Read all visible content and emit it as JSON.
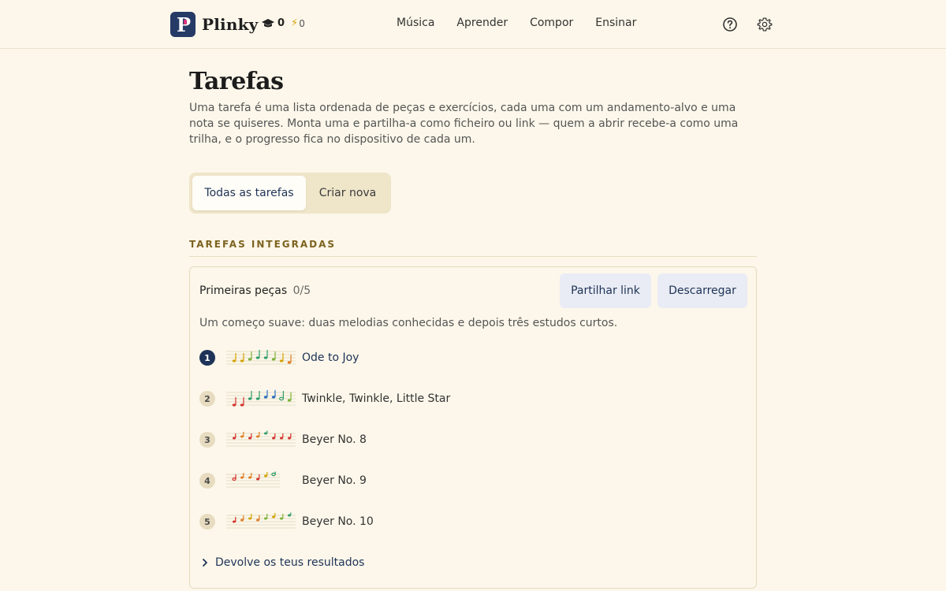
{
  "app": {
    "name": "Plinky",
    "logo_letter": "P",
    "streak_count": "0",
    "energy_count": "0",
    "brand_color": "#263a66",
    "accent_color": "#d6337a"
  },
  "nav": {
    "items": [
      "Música",
      "Aprender",
      "Compor",
      "Ensinar"
    ]
  },
  "icons": {
    "streak": "graduation-cap-icon",
    "energy": "lightning-icon",
    "help": "help-circle-icon",
    "settings": "gear-icon",
    "disclosure": "chevron-right-icon"
  },
  "page": {
    "title": "Tarefas",
    "intro": "Uma tarefa é uma lista ordenada de peças e exercícios, cada uma com um andamento-alvo e uma nota se quiseres. Monta uma e partilha-a como ficheiro ou link — quem a abrir recebe-a como uma trilha, e o progresso fica no dispositivo de cada um."
  },
  "tabs": {
    "all": "Todas as tarefas",
    "new": "Criar nova",
    "selected": "Todas as tarefas"
  },
  "section": {
    "label": "TAREFAS INTEGRADAS"
  },
  "assignment": {
    "title": "Primeiras peças",
    "progress": "0/5",
    "share_label": "Partilhar link",
    "download_label": "Descarregar",
    "description": "Um começo suave: duas melodias conhecidas e depois três estudos curtos.",
    "pieces": [
      {
        "number": "1",
        "name": "Ode to Joy",
        "current": true
      },
      {
        "number": "2",
        "name": "Twinkle, Twinkle, Little Star",
        "current": false
      },
      {
        "number": "3",
        "name": "Beyer No. 8",
        "current": false
      },
      {
        "number": "4",
        "name": "Beyer No. 9",
        "current": false
      },
      {
        "number": "5",
        "name": "Beyer No. 10",
        "current": false
      }
    ],
    "results_label": "Devolve os teus resultados"
  }
}
